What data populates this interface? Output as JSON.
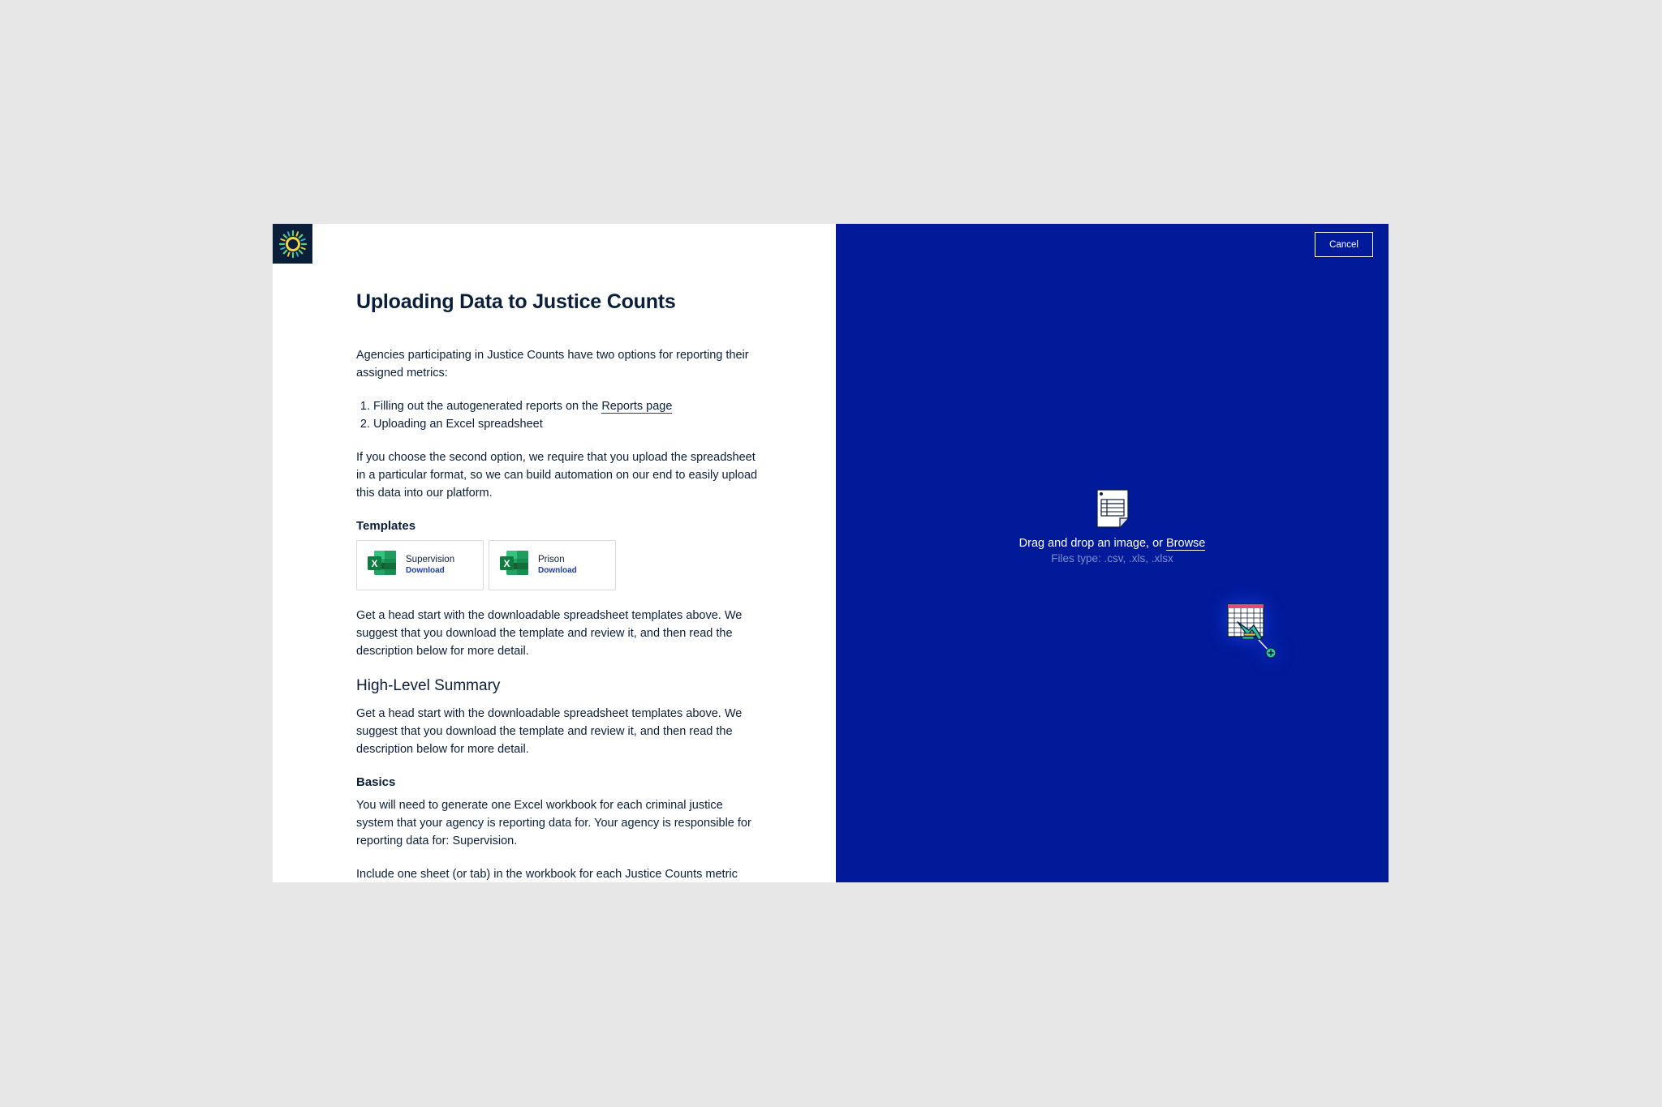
{
  "left_panel": {
    "title": "Uploading Data to Justice Counts",
    "intro": "Agencies participating in Justice Counts have two options for reporting their assigned metrics:",
    "options": {
      "item1_prefix": "Filling out the autogenerated reports on the ",
      "item1_link": "Reports page",
      "item2": "Uploading an Excel spreadsheet"
    },
    "format_note": "If you choose the second option, we require that you upload the spreadsheet in a particular format, so we can build automation on our end to easily upload this data into our platform.",
    "templates_heading": "Templates",
    "templates": [
      {
        "name": "Supervision",
        "action": "Download"
      },
      {
        "name": "Prison",
        "action": "Download"
      }
    ],
    "headstart": "Get a head start with the downloadable spreadsheet templates above. We suggest that you download the template and review it, and then read the description below for more detail.",
    "summary_heading": "High-Level Summary",
    "summary_text": "Get a head start with the downloadable spreadsheet templates above. We suggest that you download the template and review it, and then read the description below for more detail.",
    "basics_heading": "Basics",
    "basics_text": "You will need to generate one Excel workbook for each criminal justice system that your agency is reporting data for. Your agency is responsible for reporting data for: Supervision.",
    "basics_text2": "Include one sheet (or tab) in the workbook for each Justice Counts metric"
  },
  "right_panel": {
    "cancel_label": "Cancel",
    "drop_prefix": "Drag and drop an image, or ",
    "browse_label": "Browse",
    "file_types": "Files type: .csv, .xls, .xlsx"
  },
  "icons": {
    "logo": "justice-counts-logo",
    "excel": "excel-icon",
    "document": "spreadsheet-document-icon",
    "drag": "drag-file-cursor-icon"
  },
  "colors": {
    "upload_panel_bg": "#001a9a",
    "text_dark": "#0b1f3a",
    "link_accent": "#1d3bb3",
    "excel_green": "#1d7a45",
    "background": "#e7e7e7"
  }
}
